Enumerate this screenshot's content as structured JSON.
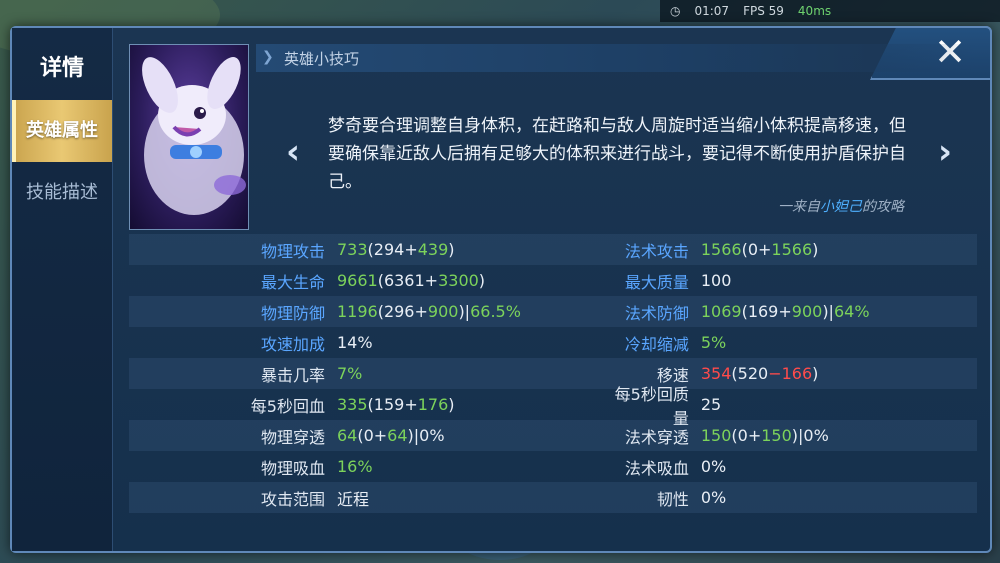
{
  "hud": {
    "time": "01:07",
    "fps": "FPS 59",
    "ping": "40ms"
  },
  "sidebar": {
    "title": "详情",
    "tabs": [
      {
        "label": "英雄属性",
        "active": true
      },
      {
        "label": "技能描述",
        "active": false
      }
    ]
  },
  "close_label": "✕",
  "tips": {
    "header": "英雄小技巧",
    "text": "梦奇要合理调整自身体积，在赶路和与敌人周旋时适当缩小体积提高移速，但要确保靠近敌人后拥有足够大的体积来进行战斗，要记得不断使用护盾保护自己。",
    "source_prefix": "一来自",
    "source_author": "小妲己",
    "source_suffix": "的攻略",
    "prev": "‹",
    "next": "›"
  },
  "stats": [
    {
      "l_label": "物理攻击",
      "l_blue": true,
      "l_value": [
        [
          "733",
          "green"
        ],
        [
          "(294+",
          "white"
        ],
        [
          "439",
          "green"
        ],
        [
          ")",
          "white"
        ]
      ],
      "r_label": "法术攻击",
      "r_blue": true,
      "r_value": [
        [
          "1566",
          "green"
        ],
        [
          "(0+",
          "white"
        ],
        [
          "1566",
          "green"
        ],
        [
          ")",
          "white"
        ]
      ]
    },
    {
      "l_label": "最大生命",
      "l_blue": true,
      "l_value": [
        [
          "9661",
          "green"
        ],
        [
          "(6361+",
          "white"
        ],
        [
          "3300",
          "green"
        ],
        [
          ")",
          "white"
        ]
      ],
      "r_label": "最大质量",
      "r_blue": true,
      "r_value": [
        [
          "100",
          "white"
        ]
      ]
    },
    {
      "l_label": "物理防御",
      "l_blue": true,
      "l_value": [
        [
          "1196",
          "green"
        ],
        [
          "(296+",
          "white"
        ],
        [
          "900",
          "green"
        ],
        [
          ")|",
          "white"
        ],
        [
          "66.5%",
          "green"
        ]
      ],
      "r_label": "法术防御",
      "r_blue": true,
      "r_value": [
        [
          "1069",
          "green"
        ],
        [
          "(169+",
          "white"
        ],
        [
          "900",
          "green"
        ],
        [
          ")|",
          "white"
        ],
        [
          "64%",
          "green"
        ]
      ]
    },
    {
      "l_label": "攻速加成",
      "l_blue": true,
      "l_value": [
        [
          "14%",
          "white"
        ]
      ],
      "r_label": "冷却缩减",
      "r_blue": true,
      "r_value": [
        [
          "5%",
          "green"
        ]
      ]
    },
    {
      "l_label": "暴击几率",
      "l_blue": false,
      "l_value": [
        [
          "7%",
          "green"
        ]
      ],
      "r_label": "移速",
      "r_blue": false,
      "r_value": [
        [
          "354",
          "red"
        ],
        [
          "(520",
          "white"
        ],
        [
          "−166",
          "red"
        ],
        [
          ")",
          "white"
        ]
      ]
    },
    {
      "l_label": "每5秒回血",
      "l_blue": false,
      "l_value": [
        [
          "335",
          "green"
        ],
        [
          "(159+",
          "white"
        ],
        [
          "176",
          "green"
        ],
        [
          ")",
          "white"
        ]
      ],
      "r_label": "每5秒回质量",
      "r_blue": false,
      "r_value": [
        [
          "25",
          "white"
        ]
      ]
    },
    {
      "l_label": "物理穿透",
      "l_blue": false,
      "l_value": [
        [
          "64",
          "green"
        ],
        [
          "(0+",
          "white"
        ],
        [
          "64",
          "green"
        ],
        [
          ")|0%",
          "white"
        ]
      ],
      "r_label": "法术穿透",
      "r_blue": false,
      "r_value": [
        [
          "150",
          "green"
        ],
        [
          "(0+",
          "white"
        ],
        [
          "150",
          "green"
        ],
        [
          ")|0%",
          "white"
        ]
      ]
    },
    {
      "l_label": "物理吸血",
      "l_blue": false,
      "l_value": [
        [
          "16%",
          "green"
        ]
      ],
      "r_label": "法术吸血",
      "r_blue": false,
      "r_value": [
        [
          "0%",
          "white"
        ]
      ]
    },
    {
      "l_label": "攻击范围",
      "l_blue": false,
      "l_value": [
        [
          "近程",
          "white"
        ]
      ],
      "r_label": "韧性",
      "r_blue": false,
      "r_value": [
        [
          "0%",
          "white"
        ]
      ]
    }
  ],
  "colors": {
    "accent_gold": "#e9c873",
    "stat_blue": "#5aa6ff",
    "stat_green": "#7cd35b",
    "stat_red": "#ff4b4b"
  }
}
